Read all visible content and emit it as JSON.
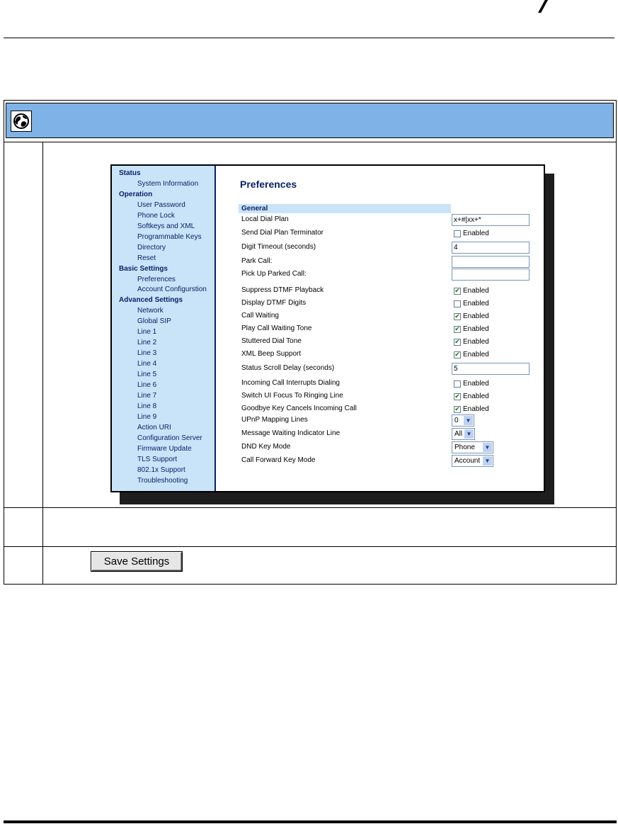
{
  "nav": {
    "sections": [
      {
        "label": "Status",
        "items": [
          "System Information"
        ]
      },
      {
        "label": "Operation",
        "items": [
          "User Password",
          "Phone Lock",
          "Softkeys and XML",
          "Programmable Keys",
          "Directory",
          "Reset"
        ]
      },
      {
        "label": "Basic Settings",
        "items": [
          "Preferences",
          "Account Configurstion"
        ]
      },
      {
        "label": "Advanced Settings",
        "items": [
          "Network",
          "Global SIP",
          "Line 1",
          "Line 2",
          "Line 3",
          "Line 4",
          "Line 5",
          "Line 6",
          "Line 7",
          "Line 8",
          "Line 9",
          "Action URI",
          "Configuration Server",
          "Firmware Update",
          "TLS Support",
          "802.1x Support",
          "Troubleshooting"
        ]
      }
    ]
  },
  "page": {
    "title": "Preferences",
    "section": "General",
    "fields": [
      {
        "label": "Local Dial Plan",
        "type": "text",
        "value": "x+#|xx+*"
      },
      {
        "label": "Send Dial Plan Terminator",
        "type": "check",
        "checked": false,
        "text": "Enabled"
      },
      {
        "label": "Digit Timeout (seconds)",
        "type": "text",
        "value": "4"
      },
      {
        "label": "Park Call:",
        "type": "text",
        "value": ""
      },
      {
        "label": "Pick Up Parked Call:",
        "type": "text",
        "value": ""
      },
      {
        "label": "Suppress DTMF Playback",
        "type": "check",
        "checked": true,
        "text": "Enabled"
      },
      {
        "label": "Display DTMF Digits",
        "type": "check",
        "checked": false,
        "text": "Enabled"
      },
      {
        "label": "Call Waiting",
        "type": "check",
        "checked": true,
        "text": "Enabled"
      },
      {
        "label": "Play Call Waiting Tone",
        "type": "check",
        "checked": true,
        "text": "Enabled"
      },
      {
        "label": "Stuttered Dial Tone",
        "type": "check",
        "checked": true,
        "text": "Enabled"
      },
      {
        "label": "XML Beep Support",
        "type": "check",
        "checked": true,
        "text": "Enabled"
      },
      {
        "label": "Status Scroll Delay (seconds)",
        "type": "text",
        "value": "5"
      },
      {
        "label": "Incoming Call Interrupts Dialing",
        "type": "check",
        "checked": false,
        "text": "Enabled"
      },
      {
        "label": "Switch UI Focus To Ringing Line",
        "type": "check",
        "checked": true,
        "text": "Enabled"
      },
      {
        "label": "Goodbye Key Cancels Incoming Call",
        "type": "check",
        "checked": true,
        "text": "Enabled"
      },
      {
        "label": "UPnP Mapping Lines",
        "type": "select",
        "value": "0"
      },
      {
        "label": "Message Waiting Indicator Line",
        "type": "select",
        "value": "All"
      },
      {
        "label": "DND Key Mode",
        "type": "select",
        "value": "Phone"
      },
      {
        "label": "Call Forward Key Mode",
        "type": "select",
        "value": "Account"
      }
    ]
  },
  "save_button": {
    "label": "Save Settings"
  },
  "icons": {
    "header": "globe-icon",
    "check": "checkmark-icon",
    "dropdown": "chevron-down-icon"
  },
  "colors": {
    "header_bar": "#7fb2e6",
    "nav_bg": "#c9e3f9",
    "nav_text": "#0a2266"
  }
}
